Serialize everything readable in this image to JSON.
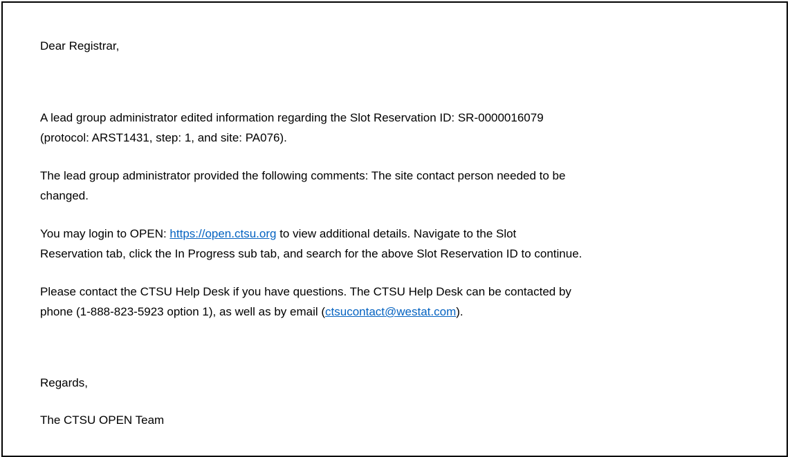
{
  "letter": {
    "greeting": "Dear Registrar,",
    "p1": {
      "line1": "A lead group administrator edited information regarding the Slot Reservation ID: SR-0000016079",
      "line2": "(protocol: ARST1431, step: 1, and site: PA076)."
    },
    "p2": {
      "line1": "The lead group administrator provided the following comments: The site contact person needed to be",
      "line2": "changed."
    },
    "p3": {
      "before_link": "You may login to OPEN: ",
      "link": "https://open.ctsu.org",
      "after_link": " to view additional details. Navigate to the Slot",
      "line2": "Reservation tab, click the In Progress sub tab, and search for the above Slot Reservation ID to continue."
    },
    "p4": {
      "line1": "Please contact the CTSU Help Desk if you have questions. The CTSU Help Desk can be contacted by",
      "before_email": "phone (1-888-823-5923 option 1), as well as by email (",
      "email": "ctsucontact@westat.com",
      "after_email": ")."
    },
    "closing": "Regards,",
    "signature": "The CTSU OPEN Team"
  },
  "colors": {
    "link": "#0563c1",
    "text": "#000000",
    "border": "#000000"
  }
}
